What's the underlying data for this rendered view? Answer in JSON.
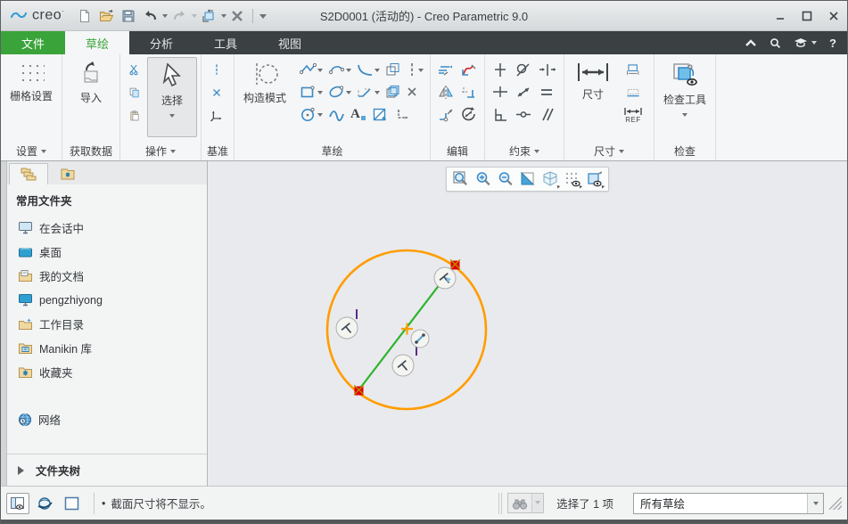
{
  "window": {
    "logo_text": "creo",
    "title": "S2D0001 (活动的) - Creo Parametric 9.0",
    "help_glyph": "?"
  },
  "tabs": {
    "file": "文件",
    "sketch": "草绘",
    "analysis": "分析",
    "tools": "工具",
    "view": "视图"
  },
  "ribbon": {
    "settings": {
      "label": "设置",
      "grid_button": "栅格设置"
    },
    "get_data": {
      "label": "获取数据",
      "import_button": "导入"
    },
    "operations": {
      "label": "操作",
      "select_button": "选择"
    },
    "datum": {
      "label": "基准"
    },
    "sketch": {
      "label": "草绘",
      "construction_button": "构造模式",
      "text_glyph": "A"
    },
    "edit": {
      "label": "编辑"
    },
    "constrain": {
      "label": "约束"
    },
    "dimension": {
      "label": "尺寸",
      "dim_button": "尺寸",
      "ref_glyph": "REF"
    },
    "inspect": {
      "label": "检查",
      "tools_button": "检查工具"
    }
  },
  "sidebar": {
    "header": "常用文件夹",
    "items": [
      {
        "label": "在会话中"
      },
      {
        "label": "桌面"
      },
      {
        "label": "我的文档"
      },
      {
        "label": "pengzhiyong"
      },
      {
        "label": "工作目录"
      },
      {
        "label": "Manikin 库"
      },
      {
        "label": "收藏夹"
      },
      {
        "label": "网络"
      }
    ],
    "footer": "文件夹树"
  },
  "statusbar": {
    "bullet": "•",
    "message": "截面尺寸将不显示。",
    "selection_count": "选择了 1 项",
    "filter_value": "所有草绘"
  },
  "colors": {
    "accent_green": "#3aa33a",
    "tab_bar_dark": "#3b4043",
    "selected_geometry_orange": "#ff9d00",
    "line_green": "#2db42d",
    "vertex_red": "#e10000",
    "constraint_tick_purple": "#5b2c83",
    "tool_blue": "#3a8ac6"
  }
}
